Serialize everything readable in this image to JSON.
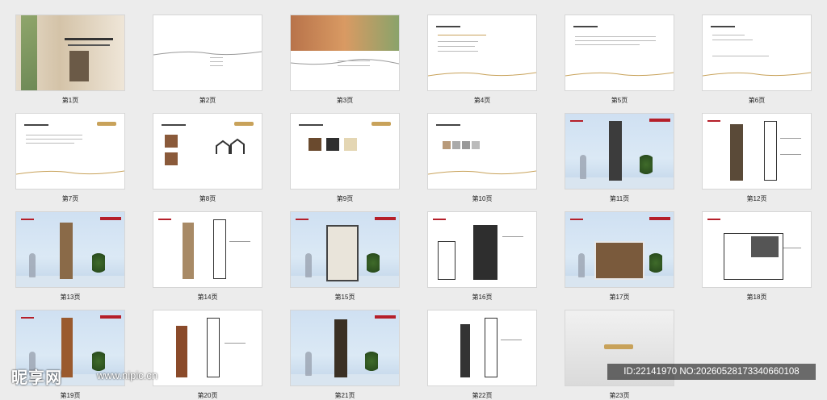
{
  "pages": [
    {
      "label": "第1页"
    },
    {
      "label": "第2页"
    },
    {
      "label": "第3页"
    },
    {
      "label": "第4页"
    },
    {
      "label": "第5页"
    },
    {
      "label": "第6页"
    },
    {
      "label": "第7页"
    },
    {
      "label": "第8页"
    },
    {
      "label": "第9页"
    },
    {
      "label": "第10页"
    },
    {
      "label": "第11页"
    },
    {
      "label": "第12页"
    },
    {
      "label": "第13页"
    },
    {
      "label": "第14页"
    },
    {
      "label": "第15页"
    },
    {
      "label": "第16页"
    },
    {
      "label": "第17页"
    },
    {
      "label": "第18页"
    },
    {
      "label": "第19页"
    },
    {
      "label": "第20页"
    },
    {
      "label": "第21页"
    },
    {
      "label": "第22页"
    },
    {
      "label": "第23页"
    }
  ],
  "watermark": {
    "brand": "昵享网",
    "url": "www.nipic.cn",
    "id": "ID:22141970 NO:20260528173340660108"
  },
  "colors": {
    "accent": "#b51f2a",
    "gold": "#c8a25a",
    "sky": "#cfe0f2"
  }
}
